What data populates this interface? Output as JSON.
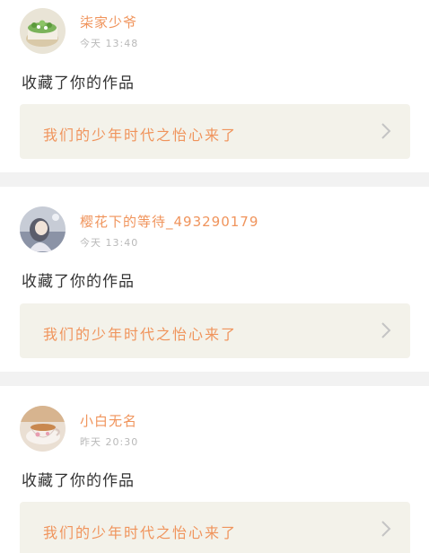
{
  "notifications": [
    {
      "username": "柒家少爷",
      "time": "今天 13:48",
      "action": "收藏了你的作品",
      "work_title": "我们的少年时代之怡心来了",
      "avatar_icon": "cake-photo"
    },
    {
      "username": "樱花下的等待_493290179",
      "time": "今天 13:40",
      "action": "收藏了你的作品",
      "work_title": "我们的少年时代之怡心来了",
      "avatar_icon": "anime-girl-photo"
    },
    {
      "username": "小白无名",
      "time": "昨天 20:30",
      "action": "收藏了你的作品",
      "work_title": "我们的少年时代之怡心来了",
      "avatar_icon": "teacup-photo"
    }
  ],
  "colors": {
    "username": "#f0945c",
    "work_title": "#f0945c",
    "work_bg": "#f3f2ea",
    "separator": "#f2f2f2",
    "time": "#b9b9b9"
  }
}
